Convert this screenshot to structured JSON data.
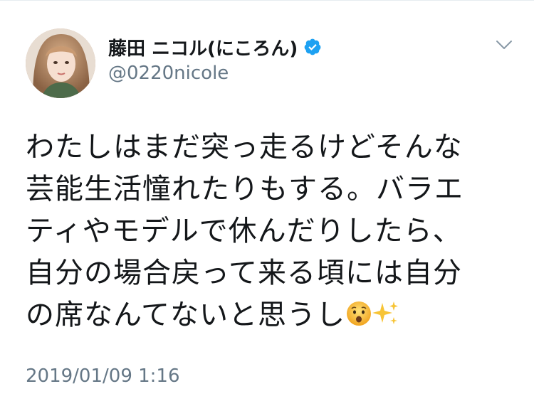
{
  "user": {
    "display_name": "藤田 ニコル(にころん)",
    "handle": "@0220nicole",
    "verified": true,
    "avatar_icon": "profile-photo"
  },
  "tweet": {
    "lines": [
      "わたしはまだ突っ走るけどそんな",
      "芸能生活憧れたりもする。バラエ",
      "ティやモデルで休んだりしたら、",
      "自分の場合戻って来る頃には自分",
      "の席なんてないと思うし"
    ],
    "emojis": [
      "worried-face-emoji",
      "sparkles-emoji"
    ],
    "timestamp": "2019/01/09 1:16"
  },
  "colors": {
    "text": "#14171a",
    "secondary": "#657786",
    "verified_blue": "#1da1f2",
    "divider": "#e6ecf0"
  }
}
